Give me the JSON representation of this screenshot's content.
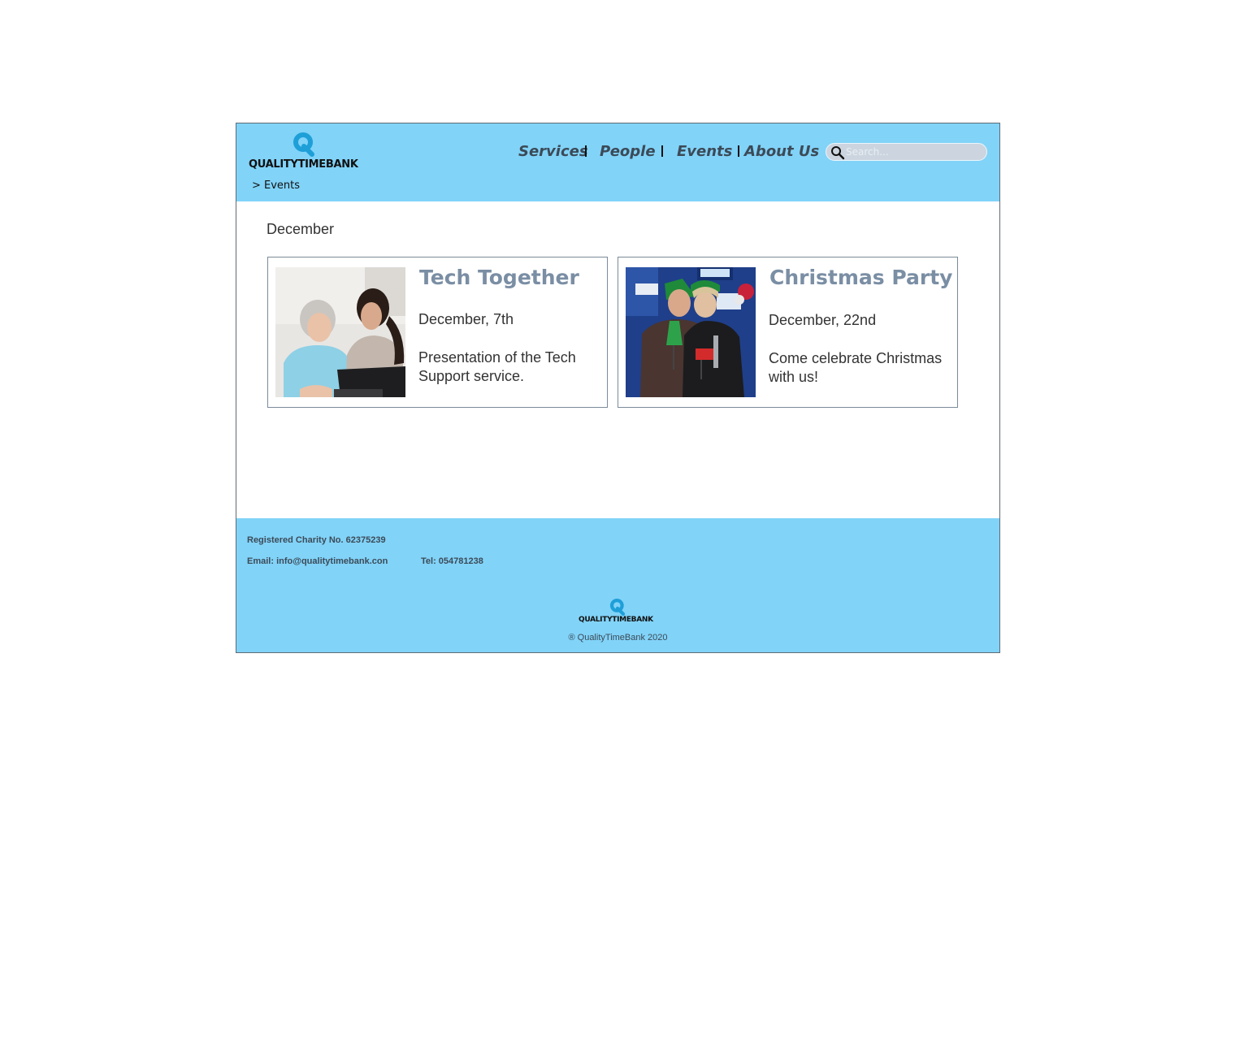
{
  "header": {
    "logo_text": "QUALITYTIMEBANK",
    "breadcrumb": "> Events",
    "nav": [
      {
        "label": "Services"
      },
      {
        "label": "People"
      },
      {
        "label": "Events"
      },
      {
        "label": "About Us"
      }
    ],
    "search": {
      "placeholder": "Search...",
      "value": ""
    }
  },
  "main": {
    "month": "December",
    "events": [
      {
        "title": "Tech Together",
        "date": "December, 7th",
        "description": "Presentation of the Tech Support service."
      },
      {
        "title": "Christmas Party",
        "date": "December, 22nd",
        "description": "Come celebrate Christmas with us!"
      }
    ]
  },
  "footer": {
    "charity": "Registered Charity No. 62375239",
    "email": "Email:  info@qualitytimebank.con",
    "tel": "Tel: 054781238",
    "logo_text": "QUALITYTIMEBANK",
    "copyright": "® QualityTimeBank 2020"
  },
  "colors": {
    "header_bg": "#81d3f8",
    "nav_text": "#3c4a57",
    "card_title": "#7a8ea4",
    "logo_q": "#1e9fd8"
  }
}
